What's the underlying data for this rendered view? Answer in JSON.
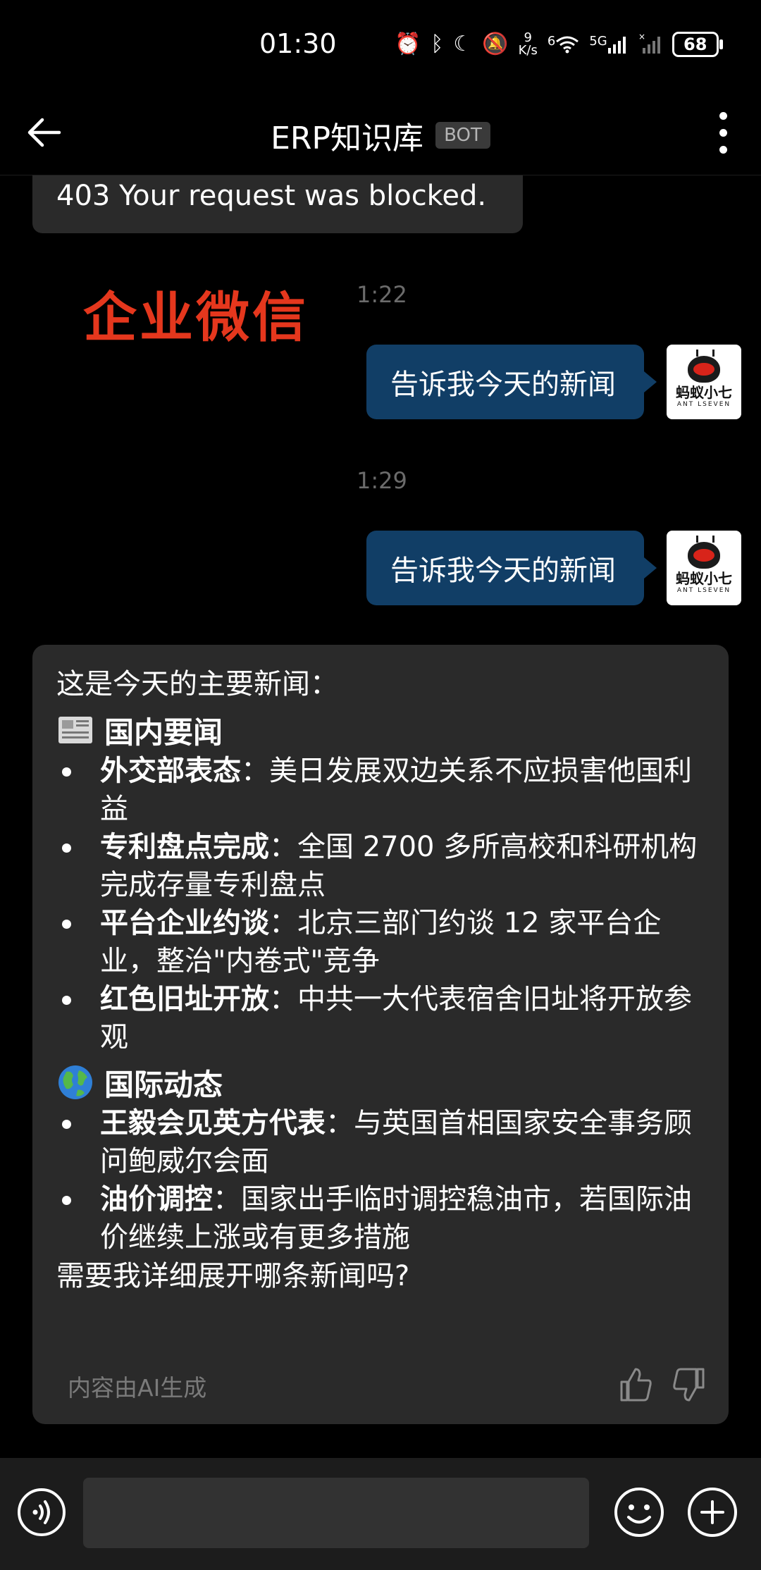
{
  "status_bar": {
    "time": "01:30",
    "net_speed_value": "9",
    "net_speed_unit": "K/s",
    "wifi_label": "6",
    "signal_label": "5G",
    "battery": "68"
  },
  "header": {
    "title": "ERP知识库",
    "badge": "BOT"
  },
  "chat": {
    "error_message": "403 Your request was blocked.",
    "watermark": "企业微信",
    "messages": [
      {
        "time": "1:22",
        "text": "告诉我今天的新闻",
        "avatar_name": "蚂蚁小七",
        "avatar_sub": "ANT LSEVEN"
      },
      {
        "time": "1:29",
        "text": "告诉我今天的新闻",
        "avatar_name": "蚂蚁小七",
        "avatar_sub": "ANT LSEVEN"
      }
    ],
    "bot_reply": {
      "intro": "这是今天的主要新闻：",
      "sections": [
        {
          "icon": "newspaper-icon",
          "title": "国内要闻",
          "items": [
            {
              "head": "外交部表态",
              "body": "：美日发展双边关系不应损害他国利益"
            },
            {
              "head": "专利盘点完成",
              "body": "：全国 2700 多所高校和科研机构完成存量专利盘点"
            },
            {
              "head": "平台企业约谈",
              "body": "：北京三部门约谈 12 家平台企业，整治\"内卷式\"竞争"
            },
            {
              "head": "红色旧址开放",
              "body": "：中共一大代表宿舍旧址将开放参观"
            }
          ]
        },
        {
          "icon": "globe-icon",
          "title": "国际动态",
          "items": [
            {
              "head": "王毅会见英方代表",
              "body": "：与英国首相国家安全事务顾问鲍威尔会面"
            },
            {
              "head": "油价调控",
              "body": "：国家出手临时调控稳油市，若国际油价继续上涨或有更多措施"
            }
          ]
        }
      ],
      "outro": "需要我详细展开哪条新闻吗?",
      "ai_note": "内容由AI生成"
    }
  },
  "input_bar": {
    "placeholder": "",
    "icons": [
      "voice-icon",
      "emoji-icon",
      "plus-icon"
    ]
  }
}
